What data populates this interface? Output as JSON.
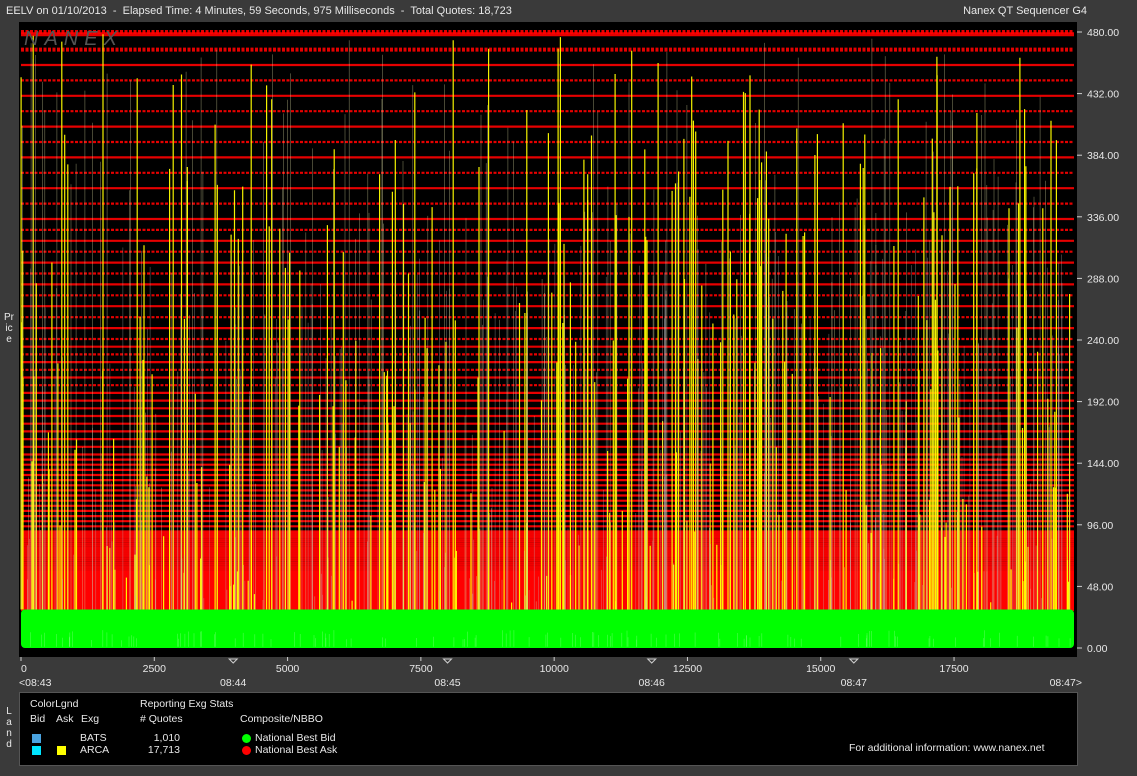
{
  "header": {
    "title": "EELV on 01/10/2013  -  Elapsed Time: 4 Minutes, 59 Seconds, 975 Milliseconds  -  Total Quotes: 18,723",
    "app_name": "Nanex QT Sequencer G4",
    "watermark": "NANEX"
  },
  "side_labels": {
    "price": "Price",
    "land": "Land"
  },
  "colors": {
    "background": "#000000",
    "bid": "#00ff00",
    "ask": "#ff0000",
    "arca_ask": "#ffff00",
    "bats": "#4aa3df",
    "arca_bid": "#00e5ff"
  },
  "chart_data": {
    "type": "scatter",
    "ylabel": "Price",
    "ylim": [
      0,
      480
    ],
    "xlim": [
      0,
      19750
    ],
    "y_ticks": [
      "480.00",
      "432.00",
      "384.00",
      "336.00",
      "288.00",
      "240.00",
      "192.00",
      "144.00",
      "96.00",
      "48.00",
      "0.00"
    ],
    "y_tick_values": [
      480,
      432,
      384,
      336,
      288,
      240,
      192,
      144,
      96,
      48,
      0
    ],
    "x_ticks": [
      "0",
      "2500",
      "5000",
      "7500",
      "10000",
      "12500",
      "15000",
      "17500"
    ],
    "x_tick_values": [
      0,
      2500,
      5000,
      7500,
      10000,
      12500,
      15000,
      17500
    ],
    "time_labels": [
      {
        "label": "<08:43",
        "x": 0
      },
      {
        "label": "08:44",
        "x": 3980
      },
      {
        "label": "08:45",
        "x": 8000
      },
      {
        "label": "08:46",
        "x": 11830
      },
      {
        "label": "08:47",
        "x": 15620
      },
      {
        "label": "08:47>",
        "x": 19750
      }
    ],
    "series": [
      {
        "name": "National Best Bid",
        "color": "#00ff00",
        "y_range": [
          0,
          30
        ]
      },
      {
        "name": "National Best Ask",
        "color": "#ff0000",
        "y_range": [
          30,
          480
        ]
      },
      {
        "name": "ARCA",
        "color": "#ffff00",
        "y_range": [
          30,
          480
        ]
      }
    ],
    "grid": false
  },
  "legend": {
    "color_legend_title": "ColorLgnd",
    "col_bid": "Bid",
    "col_ask": "Ask",
    "col_exg": "Exg",
    "stats_title": "Reporting Exg Stats",
    "col_quotes": "# Quotes",
    "composite_title": "Composite/NBBO",
    "exchanges": [
      {
        "name": "BATS",
        "quotes": "1,010",
        "bid_color": "#4aa3df",
        "ask_color": ""
      },
      {
        "name": "ARCA",
        "quotes": "17,713",
        "bid_color": "#00e5ff",
        "ask_color": "#ffff00"
      }
    ],
    "nbbo": [
      {
        "label": "National Best Bid",
        "color": "#00ff00"
      },
      {
        "label": "National Best Ask",
        "color": "#ff0000"
      }
    ],
    "info": "For additional information: www.nanex.net"
  }
}
